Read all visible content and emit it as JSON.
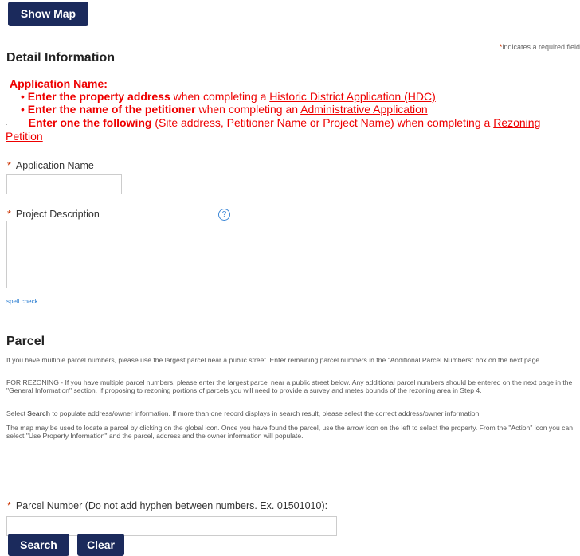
{
  "toolbar": {
    "show_map_label": "Show Map"
  },
  "required_note": {
    "asterisk": "*",
    "text": "indicates a required field"
  },
  "detail": {
    "title": "Detail Information",
    "instructions": {
      "heading": "Application Name:",
      "line1_bullet": "• ",
      "line1_bold": "Enter the property address",
      "line1_text": " when completing a ",
      "line1_link": "Historic District Application (HDC)",
      "line2_bullet": "• ",
      "line2_bold": "Enter the name of the petitioner",
      "line2_text": " when completing an ",
      "line2_link": "Administrative Application",
      "line3_bullet": "·",
      "line3_bold": "Enter one the following",
      "line3_text": " (Site address, Petitioner Name or Project Name) when completing a ",
      "line3_link_a": "Rezoning",
      "line3_link_b": "Petition"
    },
    "application_name": {
      "label": "Application Name",
      "value": ""
    },
    "project_description": {
      "label": "Project Description",
      "value": ""
    },
    "help_icon": "?",
    "spell_check": "spell check"
  },
  "parcel": {
    "title": "Parcel",
    "paragraphs": [
      "If you have multiple parcel numbers, please use the largest parcel near a public street. Enter remaining parcel numbers in the \"Additional Parcel Numbers\" box on the next page.",
      "FOR REZONING - If you have multiple parcel numbers, please enter the largest parcel near a public street below.  Any additional parcel numbers should be entered on the next page in the \"General Information\" section.  If proposing to rezoning portions of parcels you will need to provide a survey and metes bounds of the rezoning area in Step 4.",
      "The map may be used to locate a parcel by clicking on the global icon. Once you have found the parcel, use the arrow icon on the left to select the property. From the \"Action\" icon you can select \"Use Property Information\" and the parcel, address and the owner information will populate."
    ],
    "select_prefix": "Select ",
    "select_bold": "Search",
    "select_rest": " to populate address/owner information. If more than one record displays in search result, please select the correct address/owner information.",
    "parcel_number": {
      "label": "Parcel Number (Do not add hyphen between numbers. Ex. 01501010):",
      "value": ""
    },
    "search_label": "Search",
    "clear_label": "Clear"
  },
  "asterisk": "*",
  "colors": {
    "button_bg": "#1b2a5c",
    "instruction_red": "#ee0000",
    "link_blue": "#2b7ed2"
  },
  "icons": {
    "help": "question-circle-icon",
    "grip": "resize-grip-icon"
  }
}
